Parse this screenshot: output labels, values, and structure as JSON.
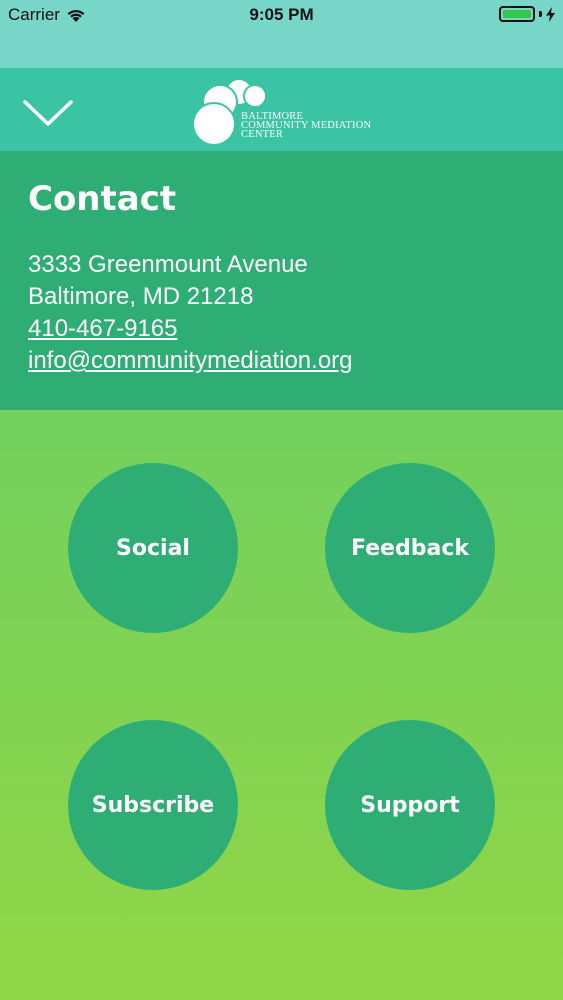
{
  "status_bar": {
    "carrier": "Carrier",
    "time": "9:05 PM",
    "icons": [
      "wifi-icon",
      "battery-icon",
      "charging-bolt-icon"
    ]
  },
  "nav_bar": {
    "back_icon": "chevron-down-icon",
    "logo": {
      "line1": "BALTIMORE",
      "line2": "COMMUNITY MEDIATION",
      "line3": "CENTER"
    }
  },
  "contact": {
    "title": "Contact",
    "address_line1": "3333 Greenmount Avenue",
    "address_line2": "Baltimore, MD 21218",
    "phone": "410-467-9165",
    "email": "info@communitymediation.org"
  },
  "buttons": {
    "social": "Social",
    "feedback": "Feedback",
    "subscribe": "Subscribe",
    "support": "Support"
  },
  "colors": {
    "status_bar_bg": "#77d6c7",
    "nav_bar_bg": "#3bc4a4",
    "panel_bg": "#2eae74",
    "gradient_top": "#62cb6a",
    "gradient_bottom": "#91d646"
  }
}
